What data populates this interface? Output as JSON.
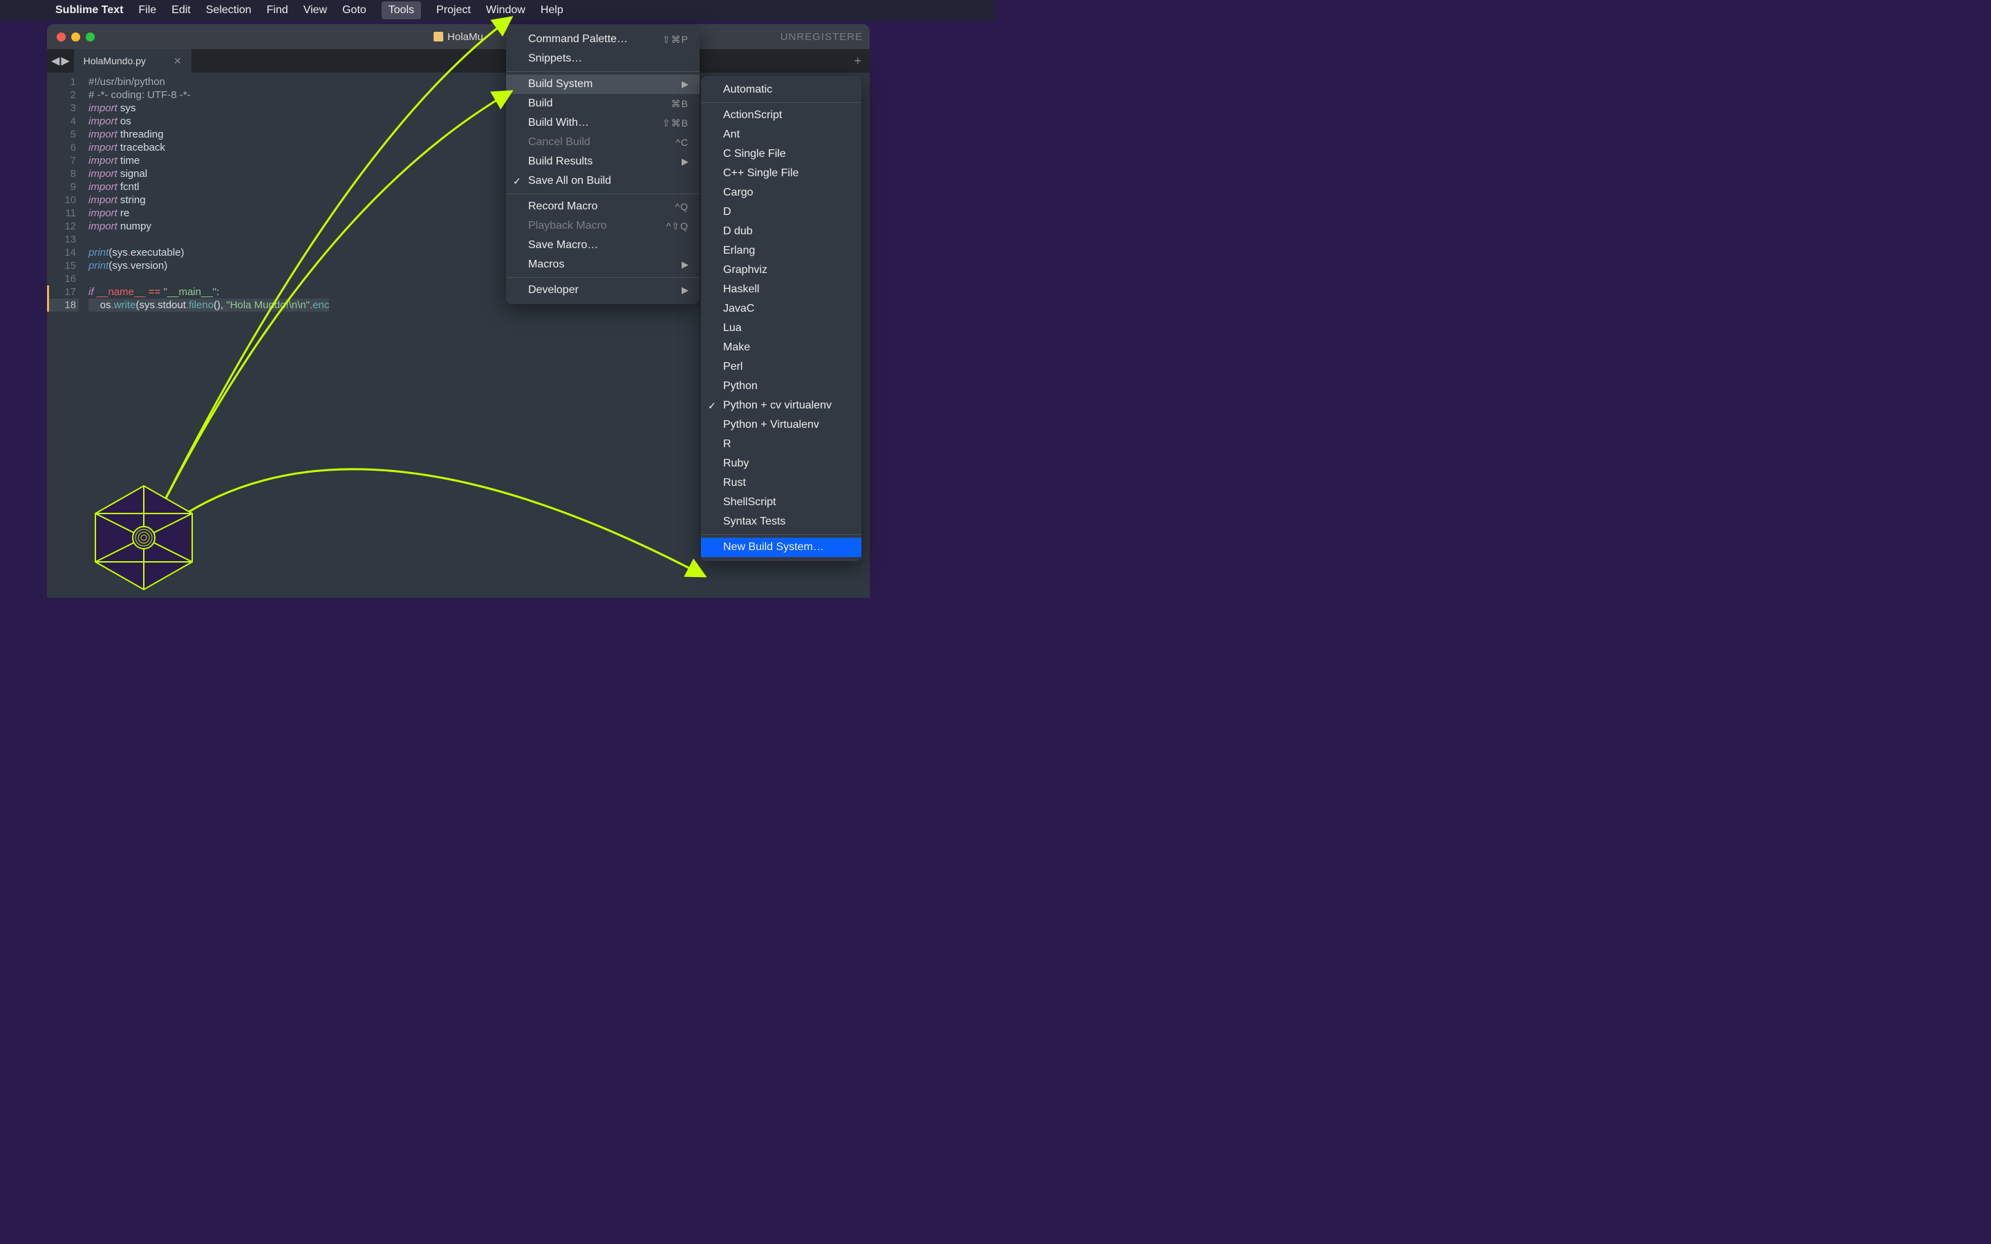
{
  "menubar": {
    "app": "Sublime Text",
    "items": [
      "File",
      "Edit",
      "Selection",
      "Find",
      "View",
      "Goto",
      "Tools",
      "Project",
      "Window",
      "Help"
    ],
    "active": "Tools"
  },
  "window": {
    "title": "HolaMu",
    "unregistered": "UNREGISTERE",
    "tab": {
      "name": "HolaMundo.py"
    }
  },
  "code": {
    "lines": [
      {
        "n": 1,
        "t": "#!/usr/bin/python",
        "cls": "c-comment"
      },
      {
        "n": 2,
        "t": "# -*- coding: UTF-8 -*-",
        "cls": "c-comment"
      },
      {
        "n": 3,
        "kw": "import",
        "mod": "sys"
      },
      {
        "n": 4,
        "kw": "import",
        "mod": "os"
      },
      {
        "n": 5,
        "kw": "import",
        "mod": "threading"
      },
      {
        "n": 6,
        "kw": "import",
        "mod": "traceback"
      },
      {
        "n": 7,
        "kw": "import",
        "mod": "time"
      },
      {
        "n": 8,
        "kw": "import",
        "mod": "signal"
      },
      {
        "n": 9,
        "kw": "import",
        "mod": "fcntl"
      },
      {
        "n": 10,
        "kw": "import",
        "mod": "string"
      },
      {
        "n": 11,
        "kw": "import",
        "mod": "re"
      },
      {
        "n": 12,
        "kw": "import",
        "mod": "numpy"
      },
      {
        "n": 13,
        "blank": true
      },
      {
        "n": 14,
        "print": "sys.executable"
      },
      {
        "n": 15,
        "print": "sys.version"
      },
      {
        "n": 16,
        "blank": true
      },
      {
        "n": 17,
        "ifmain": true
      },
      {
        "n": 18,
        "oswrite": true,
        "cur": true
      }
    ],
    "str_hola": "\"Hola Mundo!\\n\\n\"",
    "str_main": "\"__main__\"",
    "name_dunder": "__name__"
  },
  "tools_menu": [
    {
      "label": "Command Palette…",
      "short": "⇧⌘P"
    },
    {
      "label": "Snippets…"
    },
    {
      "sep": true
    },
    {
      "label": "Build System",
      "sub": true,
      "hover": true
    },
    {
      "label": "Build",
      "short": "⌘B"
    },
    {
      "label": "Build With…",
      "short": "⇧⌘B"
    },
    {
      "label": "Cancel Build",
      "short": "^C",
      "disabled": true
    },
    {
      "label": "Build Results",
      "sub": true
    },
    {
      "label": "Save All on Build",
      "check": true
    },
    {
      "sep": true
    },
    {
      "label": "Record Macro",
      "short": "^Q"
    },
    {
      "label": "Playback Macro",
      "short": "^⇧Q",
      "disabled": true
    },
    {
      "label": "Save Macro…"
    },
    {
      "label": "Macros",
      "sub": true
    },
    {
      "sep": true
    },
    {
      "label": "Developer",
      "sub": true
    }
  ],
  "build_submenu": [
    {
      "label": "Automatic"
    },
    {
      "sep": true
    },
    {
      "label": "ActionScript"
    },
    {
      "label": "Ant"
    },
    {
      "label": "C Single File"
    },
    {
      "label": "C++ Single File"
    },
    {
      "label": "Cargo"
    },
    {
      "label": "D"
    },
    {
      "label": "D dub"
    },
    {
      "label": "Erlang"
    },
    {
      "label": "Graphviz"
    },
    {
      "label": "Haskell"
    },
    {
      "label": "JavaC"
    },
    {
      "label": "Lua"
    },
    {
      "label": "Make"
    },
    {
      "label": "Perl"
    },
    {
      "label": "Python"
    },
    {
      "label": "Python + cv virtualenv",
      "check": true
    },
    {
      "label": "Python + Virtualenv"
    },
    {
      "label": "R"
    },
    {
      "label": "Ruby"
    },
    {
      "label": "Rust"
    },
    {
      "label": "ShellScript"
    },
    {
      "label": "Syntax Tests"
    },
    {
      "sep": true
    },
    {
      "label": "New Build System…",
      "sel": true
    }
  ]
}
